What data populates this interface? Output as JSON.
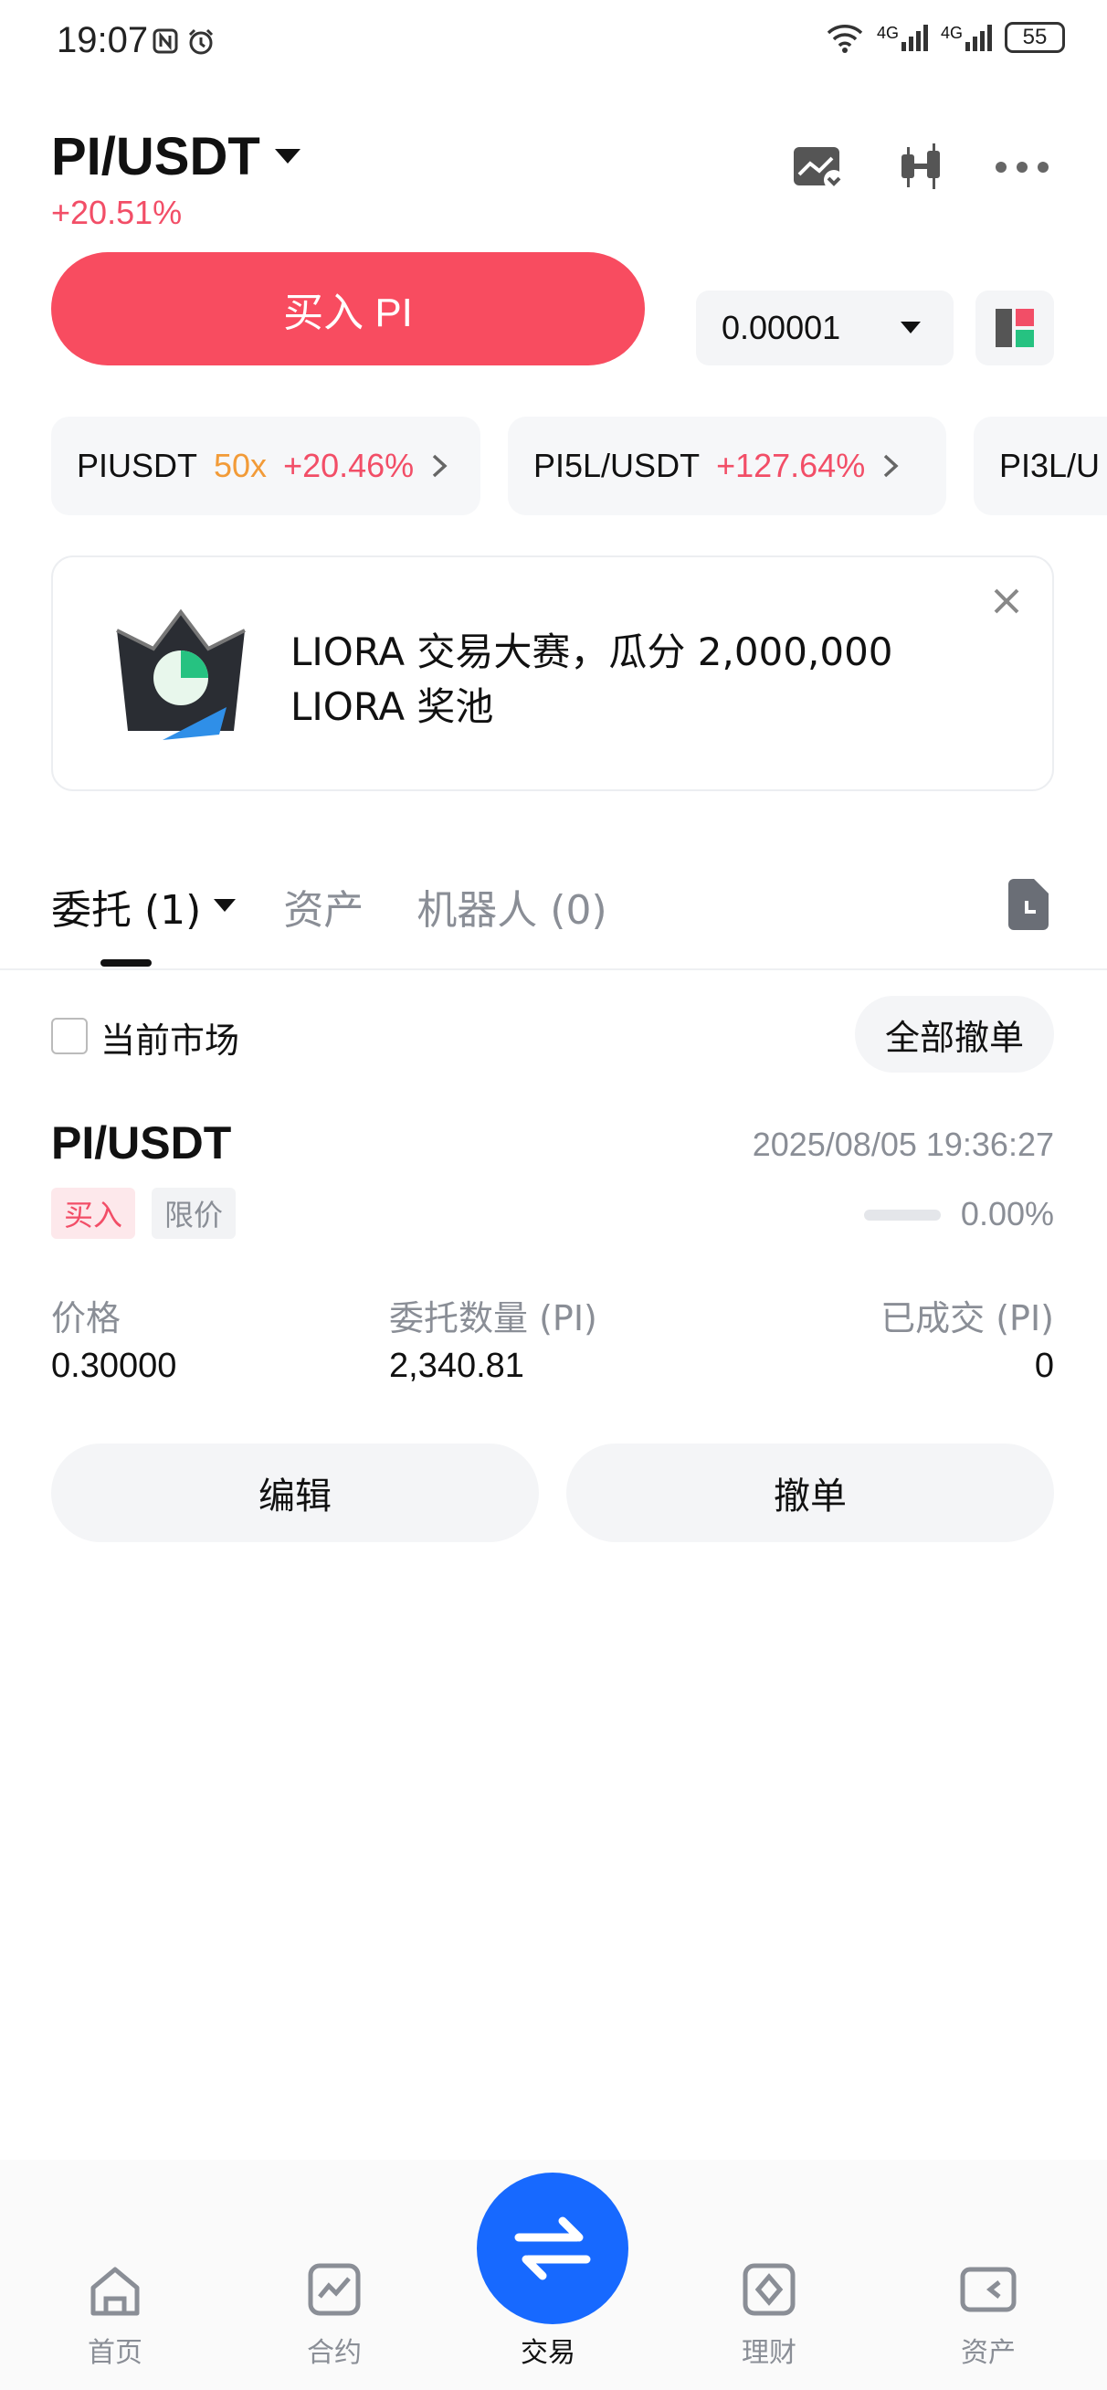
{
  "status_bar": {
    "time": "19:07",
    "network_1": "4G",
    "network_2": "4G",
    "battery": "55"
  },
  "header": {
    "pair": "PI/USDT",
    "change": "+20.51%",
    "icons": [
      "chart-settings-icon",
      "candlestick-icon",
      "more-icon"
    ]
  },
  "actions": {
    "buy_label": "买入 PI",
    "precision": "0.00001"
  },
  "related": [
    {
      "pair": "PIUSDT",
      "leverage": "50x",
      "change": "+20.46%"
    },
    {
      "pair": "PI5L/USDT",
      "change": "+127.64%"
    },
    {
      "pair": "PI3L/U"
    }
  ],
  "banner": {
    "text": "LIORA 交易大赛，瓜分 2,000,000 LIORA 奖池"
  },
  "tabs": [
    {
      "label": "委托 (1)",
      "active": true
    },
    {
      "label": "资产"
    },
    {
      "label": "机器人 (0)"
    }
  ],
  "filter": {
    "current_market": "当前市场",
    "cancel_all": "全部撤单"
  },
  "order": {
    "pair": "PI/USDT",
    "time": "2025/08/05 19:36:27",
    "side": "买入",
    "type": "限价",
    "filled_pct": "0.00%",
    "price_label": "价格",
    "price": "0.30000",
    "qty_label": "委托数量 (PI)",
    "qty": "2,340.81",
    "filled_label": "已成交 (PI)",
    "filled": "0",
    "edit": "编辑",
    "cancel": "撤单"
  },
  "bottom_nav": [
    {
      "label": "首页",
      "icon": "home-icon"
    },
    {
      "label": "合约",
      "icon": "futures-icon"
    },
    {
      "label": "交易",
      "icon": "swap-icon"
    },
    {
      "label": "理财",
      "icon": "finance-icon"
    },
    {
      "label": "资产",
      "icon": "wallet-icon"
    }
  ],
  "colors": {
    "accent_red": "#f84c60",
    "blue": "#1769ff",
    "orange": "#f29b38"
  }
}
